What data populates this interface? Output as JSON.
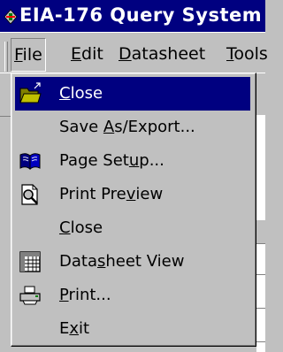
{
  "window": {
    "title": "EIA-176 Query System"
  },
  "menubar": {
    "items": [
      {
        "label": "File",
        "mnemonic_index": 0
      },
      {
        "label": "Edit",
        "mnemonic_index": 0
      },
      {
        "label": "Datasheet",
        "mnemonic_index": 0
      },
      {
        "label": "Tools",
        "mnemonic_index": 0
      }
    ]
  },
  "file_menu": {
    "items": [
      {
        "label": "Close",
        "mnemonic_index": 0,
        "icon": "open-folder-icon",
        "selected": true
      },
      {
        "label": "Save As/Export...",
        "mnemonic_index": 5,
        "icon": ""
      },
      {
        "label": "Page Setup...",
        "mnemonic_index": 8,
        "icon": "book-icon"
      },
      {
        "label": "Print Preview",
        "mnemonic_index": 9,
        "icon": "print-preview-icon"
      },
      {
        "label": "Close",
        "mnemonic_index": 0,
        "icon": ""
      },
      {
        "label": "Datasheet View",
        "mnemonic_index": 4,
        "icon": "datasheet-icon"
      },
      {
        "label": "Print...",
        "mnemonic_index": 0,
        "icon": "printer-icon"
      },
      {
        "label": "Exit",
        "mnemonic_index": 1,
        "icon": ""
      }
    ]
  },
  "colors": {
    "selection": "#000080",
    "titlebar": "#000080",
    "face": "#c0c0c0"
  }
}
